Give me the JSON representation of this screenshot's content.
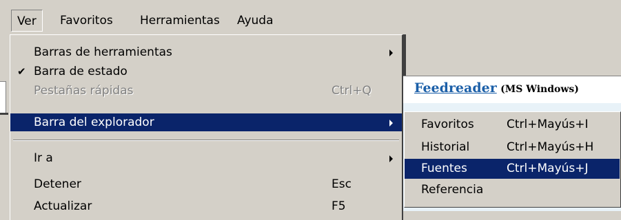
{
  "menubar": {
    "items": [
      {
        "label": "Ver",
        "active": true
      },
      {
        "label": "Favoritos"
      },
      {
        "label": "Herramientas"
      },
      {
        "label": "Ayuda"
      }
    ]
  },
  "background": {
    "link_name": "Feedreader",
    "link_meta": "(MS Windows)"
  },
  "view_menu": {
    "items": [
      {
        "label": "Barras de herramientas",
        "submenu": true
      },
      {
        "label": "Barra de estado",
        "checked": true
      },
      {
        "label": "Pestañas rápidas",
        "shortcut": "Ctrl+Q",
        "disabled": true
      },
      {
        "label": "Barra del explorador",
        "submenu": true,
        "highlighted": true
      },
      {
        "label": "Ir a",
        "submenu": true
      },
      {
        "label": "Detener",
        "shortcut": "Esc"
      },
      {
        "label": "Actualizar",
        "shortcut": "F5"
      }
    ]
  },
  "explorer_submenu": {
    "items": [
      {
        "label": "Favoritos",
        "shortcut": "Ctrl+Mayús+I"
      },
      {
        "label": "Historial",
        "shortcut": "Ctrl+Mayús+H"
      },
      {
        "label": "Fuentes",
        "shortcut": "Ctrl+Mayús+J",
        "highlighted": true
      },
      {
        "label": "Referencia",
        "shortcut": ""
      }
    ]
  },
  "colors": {
    "menu_bg": "#d4d0c8",
    "highlight": "#0a246a",
    "link": "#1b5fa8"
  }
}
